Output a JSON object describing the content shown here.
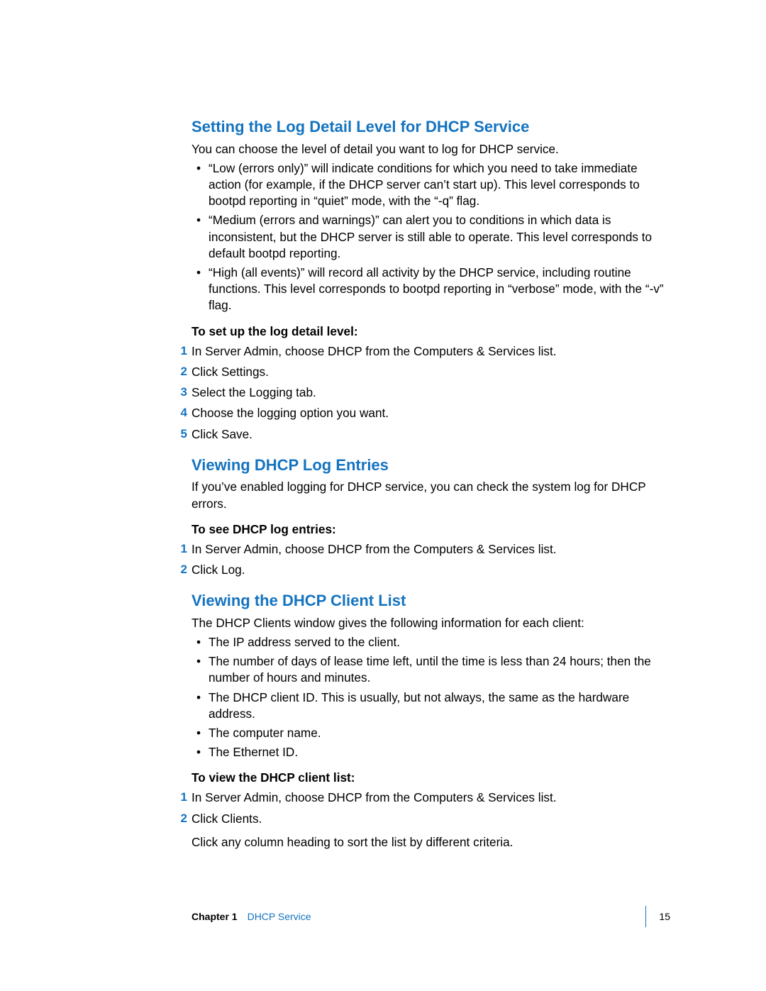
{
  "sections": {
    "a": {
      "heading": "Setting the Log Detail Level for DHCP Service",
      "intro": "You can choose the level of detail you want to log for DHCP service.",
      "bullets": [
        "“Low (errors only)” will indicate conditions for which you need to take immediate action (for example, if the DHCP server can’t start up). This level corresponds to bootpd reporting in “quiet” mode, with the “-q” flag.",
        "“Medium (errors and warnings)” can alert you to conditions in which data is inconsistent, but the DHCP server is still able to operate. This level corresponds to default bootpd reporting.",
        "“High (all events)” will record all activity by the DHCP service, including routine functions. This level corresponds to bootpd reporting in “verbose” mode, with the “-v” flag."
      ],
      "procHeading": "To set up the log detail level:",
      "steps": [
        "In Server Admin, choose DHCP from the Computers & Services list.",
        "Click Settings.",
        "Select the Logging tab.",
        "Choose the logging option you want.",
        "Click Save."
      ]
    },
    "b": {
      "heading": "Viewing DHCP Log Entries",
      "intro": "If you’ve enabled logging for DHCP service, you can check the system log for DHCP errors.",
      "procHeading": "To see DHCP log entries:",
      "steps": [
        "In Server Admin, choose DHCP from the Computers & Services list.",
        "Click Log."
      ]
    },
    "c": {
      "heading": "Viewing the DHCP Client List",
      "intro": "The DHCP Clients window gives the following information for each client:",
      "bullets": [
        "The IP address served to the client.",
        "The number of days of lease time left, until the time is less than 24 hours; then the number of hours and minutes.",
        "The DHCP client ID. This is usually, but not always, the same as the hardware address.",
        "The computer name.",
        "The Ethernet ID."
      ],
      "procHeading": "To view the DHCP client list:",
      "steps": [
        "In Server Admin, choose DHCP from the Computers & Services list.",
        "Click Clients."
      ],
      "closing": "Click any column heading to sort the list by different criteria."
    }
  },
  "numbers": {
    "n1": "1",
    "n2": "2",
    "n3": "3",
    "n4": "4",
    "n5": "5"
  },
  "footer": {
    "chapterLabel": "Chapter 1",
    "chapterTitle": "DHCP Service",
    "pageNum": "15"
  }
}
